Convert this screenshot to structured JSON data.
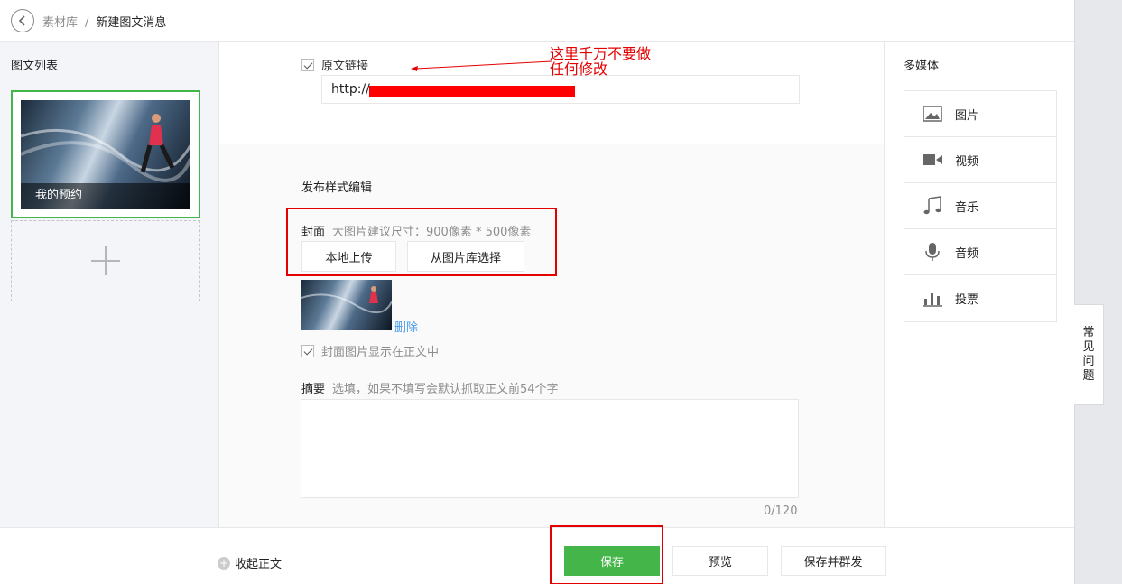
{
  "breadcrumb": {
    "parent": "素材库",
    "separator": "/",
    "current": "新建图文消息"
  },
  "article_list": {
    "title": "图文列表",
    "items": [
      {
        "caption": "我的预约"
      }
    ]
  },
  "original_link": {
    "label": "原文链接",
    "value": "http://",
    "checked": true
  },
  "annotation": {
    "line1": "这里千万不要做",
    "line2": "任何修改",
    "color": "#e50000"
  },
  "publish": {
    "title": "发布样式编辑",
    "cover_label": "封面",
    "cover_hint": "大图片建议尺寸：900像素 * 500像素",
    "upload_local": "本地上传",
    "choose_from_library": "从图片库选择",
    "delete": "删除",
    "show_in_body": "封面图片显示在正文中"
  },
  "abstract": {
    "label": "摘要",
    "hint": "选填，如果不填写会默认抓取正文前54个字",
    "counter": "0/120"
  },
  "multimedia": {
    "title": "多媒体",
    "items": [
      {
        "label": "图片",
        "icon": "image-icon"
      },
      {
        "label": "视频",
        "icon": "video-icon"
      },
      {
        "label": "音乐",
        "icon": "music-icon"
      },
      {
        "label": "音频",
        "icon": "microphone-icon"
      },
      {
        "label": "投票",
        "icon": "poll-icon"
      }
    ]
  },
  "faq": {
    "chars": [
      "常",
      "见",
      "问",
      "题"
    ]
  },
  "footer": {
    "collapse": "收起正文",
    "save": "保存",
    "preview": "预览",
    "save_and_publish": "保存并群发"
  },
  "colors": {
    "accent_green": "#44b549",
    "link_blue": "#459ae9",
    "annotation_red": "#e50000"
  }
}
